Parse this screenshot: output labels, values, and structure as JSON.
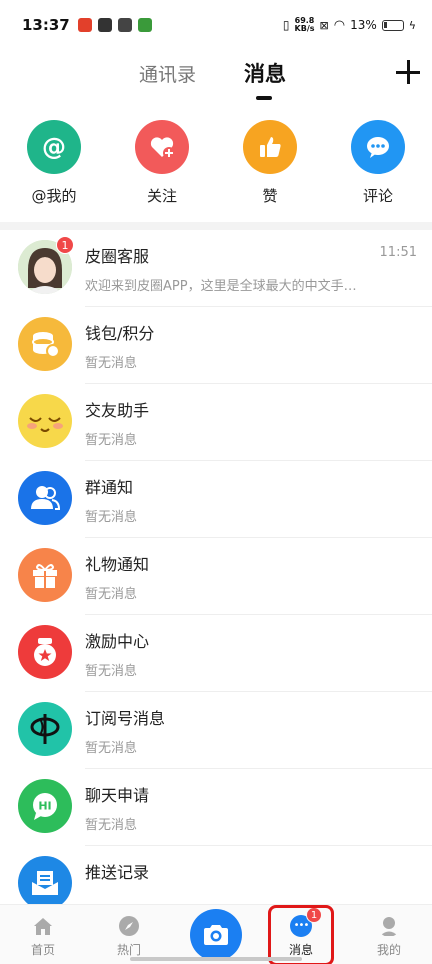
{
  "status_bar": {
    "time": "13:37",
    "net_speed_value": "69.8",
    "net_speed_unit": "KB/s",
    "battery_percent": "13%"
  },
  "header": {
    "tab_contacts": "通讯录",
    "tab_messages": "消息",
    "active_tab": "消息"
  },
  "quick_actions": [
    {
      "label": "@我的",
      "icon": "at-icon",
      "color": "#1fb58a"
    },
    {
      "label": "关注",
      "icon": "heart-plus-icon",
      "color": "#f25a5a"
    },
    {
      "label": "赞",
      "icon": "thumbs-up-icon",
      "color": "#f7a421"
    },
    {
      "label": "评论",
      "icon": "comment-icon",
      "color": "#2196f3"
    }
  ],
  "messages": [
    {
      "title": "皮圈客服",
      "subtitle": "欢迎来到皮圈APP，这里是全球最大的中文手…",
      "time": "11:51",
      "badge": "1",
      "icon": "avatar-photo",
      "color": "#cfe6c8"
    },
    {
      "title": "钱包/积分",
      "subtitle": "暂无消息",
      "icon": "coins-icon",
      "color": "#f6b93b"
    },
    {
      "title": "交友助手",
      "subtitle": "暂无消息",
      "icon": "smiley-face-icon",
      "color": "#f7d84a"
    },
    {
      "title": "群通知",
      "subtitle": "暂无消息",
      "icon": "group-icon",
      "color": "#1a73e8"
    },
    {
      "title": "礼物通知",
      "subtitle": "暂无消息",
      "icon": "gift-icon",
      "color": "#f7844a"
    },
    {
      "title": "激励中心",
      "subtitle": "暂无消息",
      "icon": "medal-icon",
      "color": "#ee3b3b"
    },
    {
      "title": "订阅号消息",
      "subtitle": "暂无消息",
      "icon": "subscription-icon",
      "color": "#21c3a8"
    },
    {
      "title": "聊天申请",
      "subtitle": "暂无消息",
      "icon": "chat-hi-icon",
      "color": "#2dbd5b"
    },
    {
      "title": "推送记录",
      "subtitle": "",
      "icon": "mail-tray-icon",
      "color": "#1e88e5"
    }
  ],
  "bottom_nav": {
    "home": "首页",
    "hot": "热门",
    "messages": "消息",
    "messages_badge": "1",
    "mine": "我的"
  }
}
